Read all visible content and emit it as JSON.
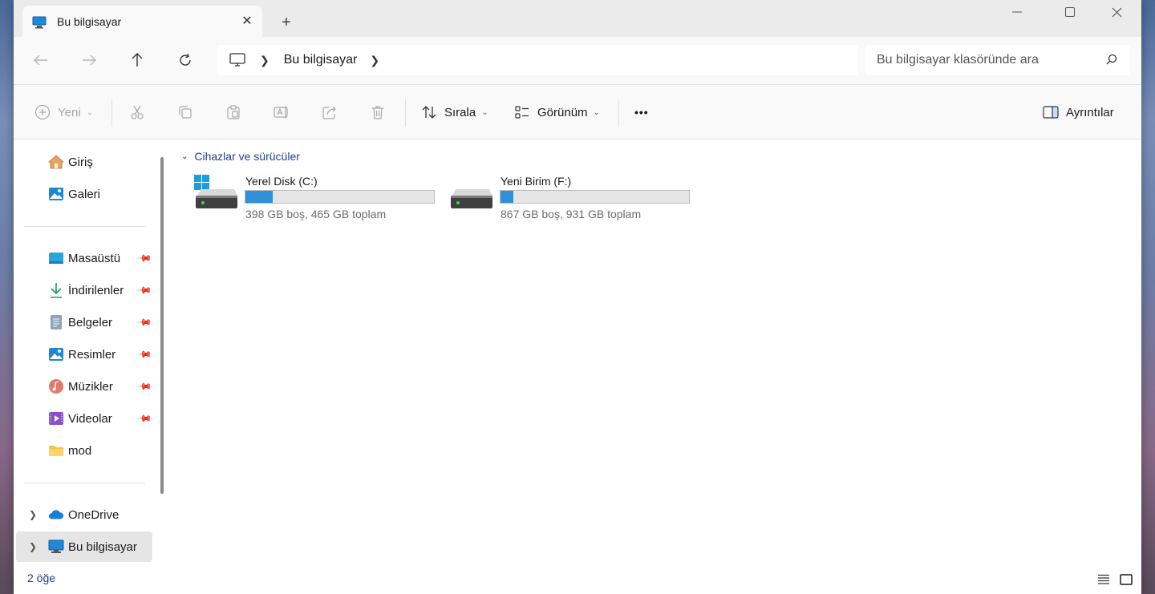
{
  "window": {
    "tab_title": "Bu bilgisayar",
    "tab_close_icon": "close-icon",
    "new_tab_label": "+",
    "controls": [
      "minimize-icon",
      "maximize-icon",
      "close-icon"
    ]
  },
  "address": {
    "crumb": "Bu bilgisayar",
    "search_placeholder": "Bu bilgisayar klasöründe ara"
  },
  "toolbar": {
    "new_label": "Yeni",
    "sort_label": "Sırala",
    "view_label": "Görünüm",
    "more_label": "•••",
    "details_label": "Ayrıntılar"
  },
  "sidebar": {
    "top": [
      {
        "label": "Giriş",
        "icon": "home-icon"
      },
      {
        "label": "Galeri",
        "icon": "gallery-icon"
      }
    ],
    "pinned": [
      {
        "label": "Masaüstü",
        "icon": "desktop-folder-icon"
      },
      {
        "label": "İndirilenler",
        "icon": "download-icon"
      },
      {
        "label": "Belgeler",
        "icon": "documents-icon"
      },
      {
        "label": "Resimler",
        "icon": "pictures-icon"
      },
      {
        "label": "Müzikler",
        "icon": "music-icon"
      },
      {
        "label": "Videolar",
        "icon": "videos-icon"
      },
      {
        "label": "mod",
        "icon": "folder-icon"
      }
    ],
    "bottom": [
      {
        "label": "OneDrive",
        "icon": "cloud-icon"
      },
      {
        "label": "Bu bilgisayar",
        "icon": "computer-icon",
        "selected": true
      }
    ]
  },
  "content": {
    "group_label": "Cihazlar ve sürücüler",
    "drives": [
      {
        "name": "Yerel Disk (C:)",
        "size_text": "398 GB boş, 465 GB toplam",
        "used_fraction": 0.144
      },
      {
        "name": "Yeni Birim (F:)",
        "size_text": "867 GB boş, 931 GB toplam",
        "used_fraction": 0.069
      }
    ]
  },
  "status": {
    "count": "2 öğe"
  },
  "colors": {
    "accent": "#2f8fd8",
    "link": "#1f3f8f",
    "selected_bg": "#e5e5e5"
  }
}
